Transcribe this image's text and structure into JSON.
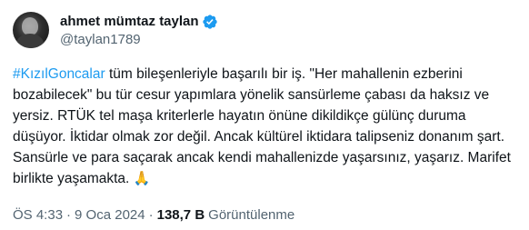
{
  "author": {
    "display_name": "ahmet mümtaz taylan",
    "handle": "@taylan1789",
    "verified_icon": "verified-badge-icon",
    "verified_color": "#1d9bf0"
  },
  "tweet": {
    "hashtag": "#KızılGoncalar",
    "text_after_hashtag": " tüm bileşenleriyle başarılı bir iş. \"Her mahallenin ezberini bozabilecek\" bu tür cesur yapımlara yönelik sansürleme çabası da haksız ve yersiz. RTÜK tel maşa kriterlerle hayatın önüne dikildikçe gülünç duruma düşüyor. İktidar olmak zor değil. Ancak kültürel iktidara talipseniz donanım şart. Sansürle ve para saçarak ancak kendi mahallenizde yaşarsınız, yaşarız. Marifet birlikte yaşamakta. ",
    "emoji": "🙏"
  },
  "meta": {
    "time": "ÖS 4:33",
    "separator": "·",
    "date": "9 Oca 2024",
    "views_count": "138,7 B",
    "views_label": "Görüntülenme"
  }
}
